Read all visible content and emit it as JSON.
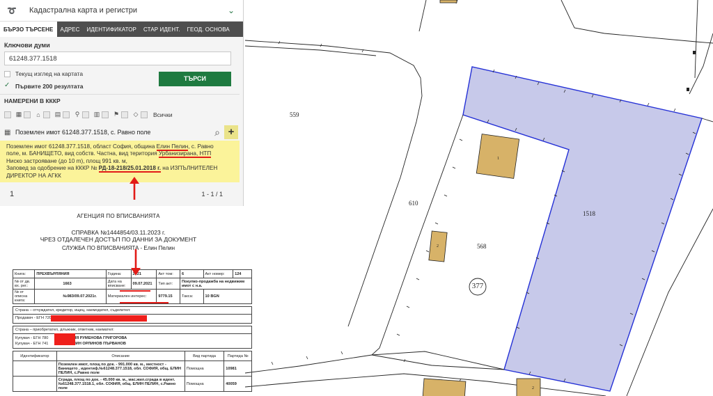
{
  "app": {
    "title": "Кадастрална карта и регистри"
  },
  "tabs": [
    {
      "label": "БЪРЗО ТЪРСЕНЕ",
      "active": true
    },
    {
      "label": "АДРЕС",
      "active": false
    },
    {
      "label": "ИДЕНТИФИКАТОР",
      "active": false
    },
    {
      "label": "СТАР ИДЕНТ.",
      "active": false
    },
    {
      "label": "ГЕОД. ОСНОВА",
      "active": false
    }
  ],
  "search": {
    "keywords_label": "Ключови думи",
    "keywords_value": "61248.377.1518",
    "current_view_label": "Текущ изглед на картата",
    "first_200_label": "Първите 200 резултата",
    "search_button": "ТЪРСИ"
  },
  "results": {
    "found_heading": "НАМЕРЕНИ В КККР",
    "filter_all_label": "Всички",
    "result_item": "Поземлен имот 61248.377.1518, с. Равно поле",
    "info": {
      "line1_a": "Поземлен имот 61248.377.1518, област София, община ",
      "line1_b": "Елин Пелин",
      "line1_c": ", с. Равно",
      "line2_a": "поле, м. БАНИЩЕТО, вид собств. Частна, вид територия ",
      "line2_b": "Урбанизирана, НТП",
      "line3": "Ниско застрояване (до 10 m), площ 991 кв. м,",
      "line4_a": "Заповед за одобрение на КККР № ",
      "line4_b": "РД-18-218/25.01.2018 г.",
      "line4_c": " на ИЗПЪЛНИТЕЛЕН",
      "line5": "ДИРЕКТОР НА АГКК"
    },
    "page_number": "1",
    "page_range": "1 - 1 / 1"
  },
  "document": {
    "agency": "АГЕНЦИЯ ПО ВПИСВАНИЯТА",
    "ref_line1": "СПРАВКА №1444854/03.11.2023 г.",
    "ref_line2": "ЧРЕЗ ОТДАЛЕЧЕН ДОСТЪП ПО ДАННИ ЗА ДОКУМЕНТ",
    "service": "СЛУЖБА ПО ВПИСВАНИЯТА - Елин Пелин",
    "meta": {
      "book_label": "Книга:",
      "book_value": "ПРЕХВЪРЛЯНИЯ",
      "year_label": "Година:",
      "year_value": "2021",
      "act_vol_label": "Акт том:",
      "act_vol_value": "6",
      "act_num_label": "Акт номер:",
      "act_num_value": "124",
      "reg_label": "№ от дв. вх. рег.:",
      "reg_value": "1663",
      "entry_date_label": "Дата на вписване:",
      "entry_date_value": "09.07.2021",
      "act_type_label": "Тип акт:",
      "act_type_value": "Покупко-продажба на недвижим имот с н.а.",
      "ledger_label": "№ от описна книга:",
      "ledger_value": "№983/09.07.2021г.",
      "interest_label": "Материален интерес:",
      "interest_value": "9779.15",
      "fee_label": "Такса:",
      "fee_value": "10 BGN"
    },
    "sellers_header": "Страна – отчуждател, кредитор, ищец, наемодател, съделител:",
    "seller": "Продавач - ЕГН 7202",
    "buyers_header": "Страна – приобретател, длъжник, ответник, наемател:",
    "buyer1_prefix": "Купувач - ЕГН 780",
    "buyer1_name": "ВАНЯ РУМЕНОВА ГРИГОРОВА",
    "buyer2_prefix": "Купувач - ЕГН 741",
    "buyer2_name": "КАЛИН ОРЛИНОВ ПЪРВАНОВ",
    "objects_headers": [
      "Идентификатор",
      "Описание",
      "Вид партида",
      "Партида №"
    ],
    "objects": [
      {
        "description": "Поземлен имот, площ по док. - 991.000 кв. м., местност - Банището , идентиф.№61248.377.1518, обл. СОФИЯ, общ. ЕЛИН ПЕЛИН, с.Равно поле",
        "type": "Помощна",
        "number": "10981"
      },
      {
        "description": "Сграда, площ по док. - 45.000 кв. м., мас.жил.сграда в идент.№61248.377.1518.1, обл. СОФИЯ, общ. ЕЛИН ПЕЛИН, с.Равно поле",
        "type": "Помощна",
        "number": "40059"
      }
    ]
  },
  "map": {
    "labels": {
      "p559": "559",
      "p610": "610",
      "p568": "568",
      "p1518": "1518",
      "block": "377",
      "b1": "1",
      "b2": "2",
      "b3": "2"
    },
    "highlight_fill": "#c7c9ea",
    "highlight_stroke": "#2430d6",
    "building_fill": "#d7b268"
  },
  "colors": {
    "accent_green": "#1f7a40",
    "tab_bar": "#4e4e4e",
    "info_yellow": "#fbf39a",
    "annotation_red": "#e21b17"
  }
}
